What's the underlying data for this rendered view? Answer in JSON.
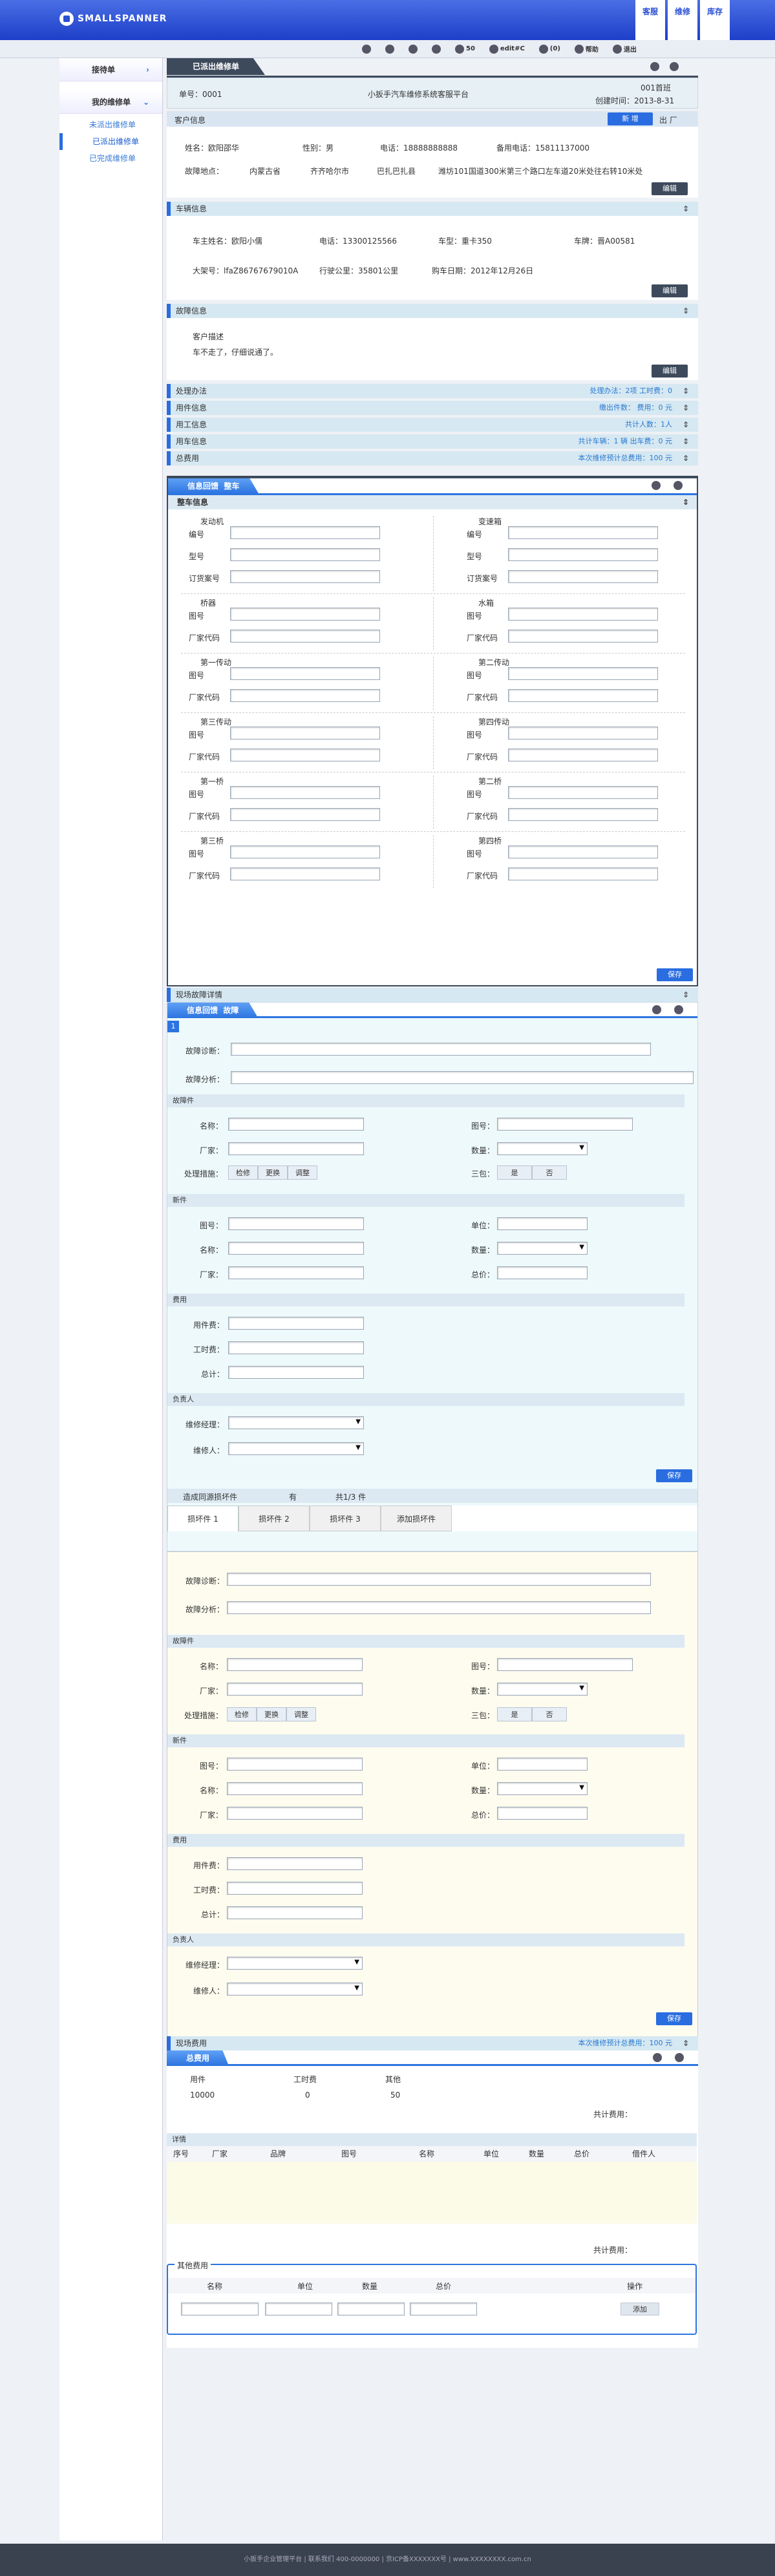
{
  "brand": {
    "logo": "SMALLSPANNER"
  },
  "topnav": [
    "客服",
    "维修",
    "库存"
  ],
  "toolbar": {
    "zoom": "50",
    "user": "edit#C",
    "count": "(0)",
    "help": "帮助",
    "logout": "退出"
  },
  "sidebar": {
    "h1": "接待单",
    "h2": "我的维修单",
    "items": [
      "未派出维修单",
      "已派出维修单",
      "已完成维修单"
    ]
  },
  "header": {
    "tab": "已派出维修单",
    "no_label": "单号：0001",
    "platform": "小扳手汽车维修系统客服平台",
    "created": "创建时间：2013-8-31",
    "status": "001首班"
  },
  "customer": {
    "title": "客户信息",
    "btn_new": "新 增",
    "btn_extra": "出 厂",
    "name": "姓名：欧阳邵华",
    "gender": "性别：男",
    "phone": "电话：18888888888",
    "phone2": "备用电话：15811137000",
    "addr_label": "故障地点：",
    "prov": "内蒙古省",
    "city": "齐齐哈尔市",
    "district": "巴扎巴扎县",
    "detail": "潍坊101国道300米第三个路口左车道20米处往右转10米处",
    "edit": "编辑"
  },
  "vehicle": {
    "title": "车辆信息",
    "owner": "车主姓名：欧阳小儒",
    "phone": "电话：13300125566",
    "model": "车型：重卡350",
    "plate": "车牌：晋A00581",
    "frame": "大架号：lfaZ86767679010A",
    "mileage": "行驶公里：35801公里",
    "buy": "购车日期：2012年12月26日",
    "edit": "编辑"
  },
  "fault": {
    "title": "故障信息",
    "desc_label": "客户描述",
    "desc": "车不走了，仔细说通了。",
    "edit": "编辑"
  },
  "bars": [
    {
      "l": "处理办法",
      "r": "处理办法：2项          工时费：0"
    },
    {
      "l": "用件信息",
      "r": "缴出件数：          费用：0 元"
    },
    {
      "l": "用工信息",
      "r": "共计人数：1人"
    },
    {
      "l": "用车信息",
      "r": "共计车辆：1 辆        出车费：0 元"
    },
    {
      "l": "总费用",
      "r": "本次维修预计总费用：100 元"
    }
  ],
  "diag": {
    "tab1": "信息回馈",
    "tab2": "整车",
    "title": "整车信息",
    "save": "保存",
    "parts": [
      {
        "a": "发动机",
        "b": "变速箱",
        "f": [
          [
            "编号",
            "编号"
          ],
          [
            "型号",
            "型号"
          ],
          [
            "订货案号",
            "订货案号"
          ]
        ]
      },
      {
        "a": "桥器",
        "b": "水箱",
        "f": [
          [
            "图号",
            "图号"
          ],
          [
            "厂家代码",
            "厂家代码"
          ]
        ]
      },
      {
        "a": "第一传动",
        "b": "第二传动",
        "f": [
          [
            "图号",
            "图号"
          ],
          [
            "厂家代码",
            "厂家代码"
          ]
        ]
      },
      {
        "a": "第三传动",
        "b": "第四传动",
        "f": [
          [
            "图号",
            "图号"
          ],
          [
            "厂家代码",
            "厂家代码"
          ]
        ]
      },
      {
        "a": "第一桥",
        "b": "第二桥",
        "f": [
          [
            "图号",
            "图号"
          ],
          [
            "厂家代码",
            "厂家代码"
          ]
        ]
      },
      {
        "a": "第三桥",
        "b": "第四桥",
        "f": [
          [
            "图号",
            "图号"
          ],
          [
            "厂家代码",
            "厂家代码"
          ]
        ]
      }
    ]
  },
  "scene": {
    "bar": "现场故障详情",
    "tab1": "信息回馈",
    "tab2": "故障",
    "num": "1",
    "diag": "故障诊断：",
    "analysis": "故障分析：",
    "fpart": "故障件",
    "name": "名称：",
    "fig": "图号：",
    "maker": "厂家：",
    "qty": "数量：",
    "method": "处理措施：",
    "m1": "检修",
    "m2": "更换",
    "m3": "调整",
    "three": "三包：",
    "yes": "是",
    "no": "否",
    "spare": "新件",
    "unit": "单位：",
    "total": "总价：",
    "fee": "费用",
    "partfee": "用件费：",
    "laborfee": "工时费：",
    "sum": "总计：",
    "resp": "负责人",
    "mgr": "维修经理：",
    "worker": "维修人：",
    "save": "保存"
  },
  "linked": {
    "bar": "造成同源损坏件",
    "has": "有",
    "count": "共1/3 件",
    "tabs": [
      "损坏件 1",
      "损坏件 2",
      "损坏件 3",
      "添加损坏件"
    ],
    "save": "保存"
  },
  "costs": {
    "bar": "现场费用",
    "bar_r": "本次维修预计总费用：100 元",
    "tab": "总费用",
    "cols": [
      "用件",
      "工时费",
      "其他"
    ],
    "vals": [
      "10000",
      "0",
      "50"
    ],
    "total": "共计费用：",
    "detail": "详情",
    "dcols": [
      "序号",
      "厂家",
      "品牌",
      "图号",
      "名称",
      "单位",
      "数量",
      "总价",
      "借件人"
    ],
    "total2": "共计费用：",
    "other_title": "其他费用",
    "ocols": [
      "名称",
      "单位",
      "数量",
      "总价",
      "操作"
    ],
    "add": "添加"
  },
  "footer": "小扳手企业管理平台 | 联系我们 400-0000000 | 京ICP备XXXXXXX号 | www.XXXXXXXX.com.cn"
}
